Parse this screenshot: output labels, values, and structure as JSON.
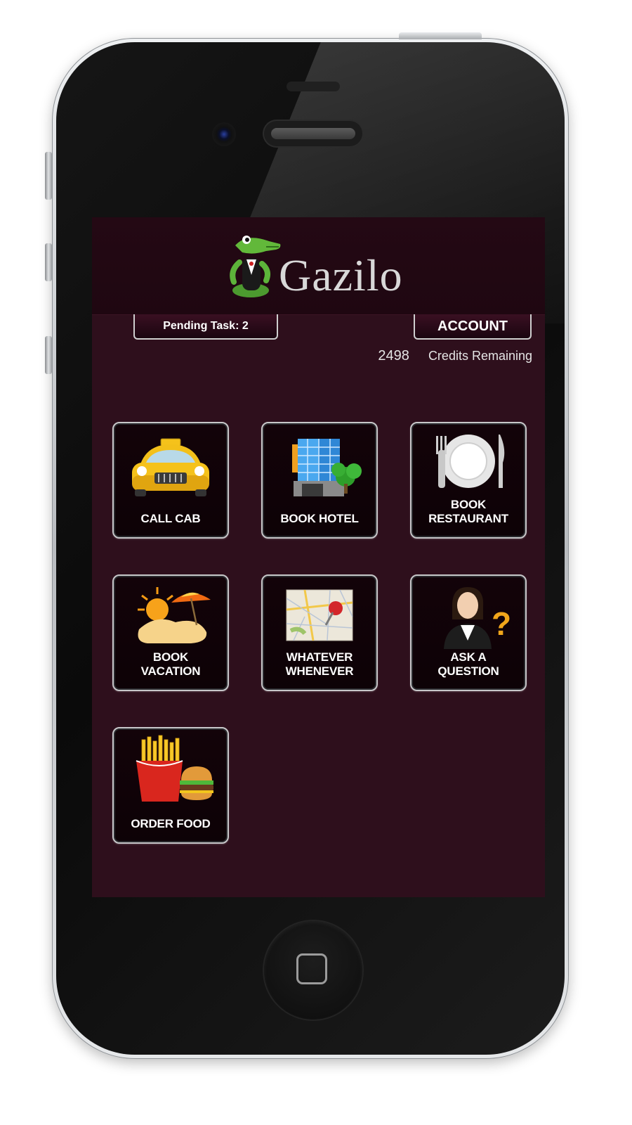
{
  "app": {
    "name": "Gazilo"
  },
  "header": {
    "pending_task_label": "Pending Task: 2",
    "account_label": "ACCOUNT"
  },
  "credits": {
    "count": "2498",
    "label": "Credits Remaining"
  },
  "tiles": [
    {
      "lines": [
        "CALL CAB"
      ],
      "icon": "taxi-icon"
    },
    {
      "lines": [
        "BOOK HOTEL"
      ],
      "icon": "hotel-icon"
    },
    {
      "lines": [
        "BOOK",
        "RESTAURANT"
      ],
      "icon": "plate-cutlery-icon"
    },
    {
      "lines": [
        "BOOK",
        "VACATION"
      ],
      "icon": "beach-icon"
    },
    {
      "lines": [
        "WHATEVER",
        "WHENEVER"
      ],
      "icon": "map-pin-icon"
    },
    {
      "lines": [
        "ASK A",
        "QUESTION"
      ],
      "icon": "question-person-icon"
    },
    {
      "lines": [
        "ORDER FOOD"
      ],
      "icon": "fast-food-icon"
    }
  ],
  "colors": {
    "screen_bg": "#2e0f1c",
    "header_bg": "#240914",
    "tile_border": "#c7c7c9",
    "taxi": "#f5c21b",
    "logo_green": "#5db33a"
  }
}
